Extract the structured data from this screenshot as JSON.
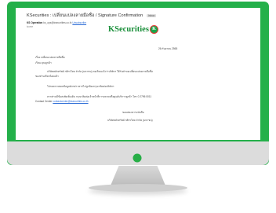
{
  "email": {
    "subject": "KSecurities : เปลี่ยนแปลงลายมือชื่อ / Signature Confirmation",
    "inbox_label": "Inbox",
    "sender_name": "KS Operation",
    "sender_addr": "ks_ops@ksecurities.co.th",
    "sender_link": "Unsubscribe",
    "recipient": "to me"
  },
  "body": {
    "logo_text": "KSecurities",
    "logo_mark": "K",
    "date": "26 กันยายน 2565",
    "subject_line": "เรื่อง  เปลี่ยนแปลงลายมือชื่อ",
    "to_line": "เรียน  คุณลูกค้า",
    "para1_line1": "บริษัทหลักทรัพย์ กสิกรไทย จำกัด (มหาชน) ขอเรียนแจ้งว่าบริษัทฯ ได้รับคำขอเปลี่ยนแปลงลายมือชื่อ",
    "para1_line2": "ของท่านเรียบร้อยแล้ว",
    "para2": "โปรดตรวจสอบข้อมูลดังกล่าวหากไม่ถูกต้องกรุณาติดต่อบริษัทฯ",
    "para3_line1": "หากท่านมีข้อสงสัยเพิ่มเติม กรุณาติดต่อเจ้าหน้าที่การตลาดหรือศูนย์บริการลูกค้า โทร 0 2796 0011",
    "para3_line2": "Contact Center",
    "para3_link": "contactcenter@ksecurities.co.th",
    "closing": "ขอแสดงความนับถือ",
    "signature": "บริษัทหลักทรัพย์ กสิกรไทย จำกัด (มหาชน)"
  }
}
